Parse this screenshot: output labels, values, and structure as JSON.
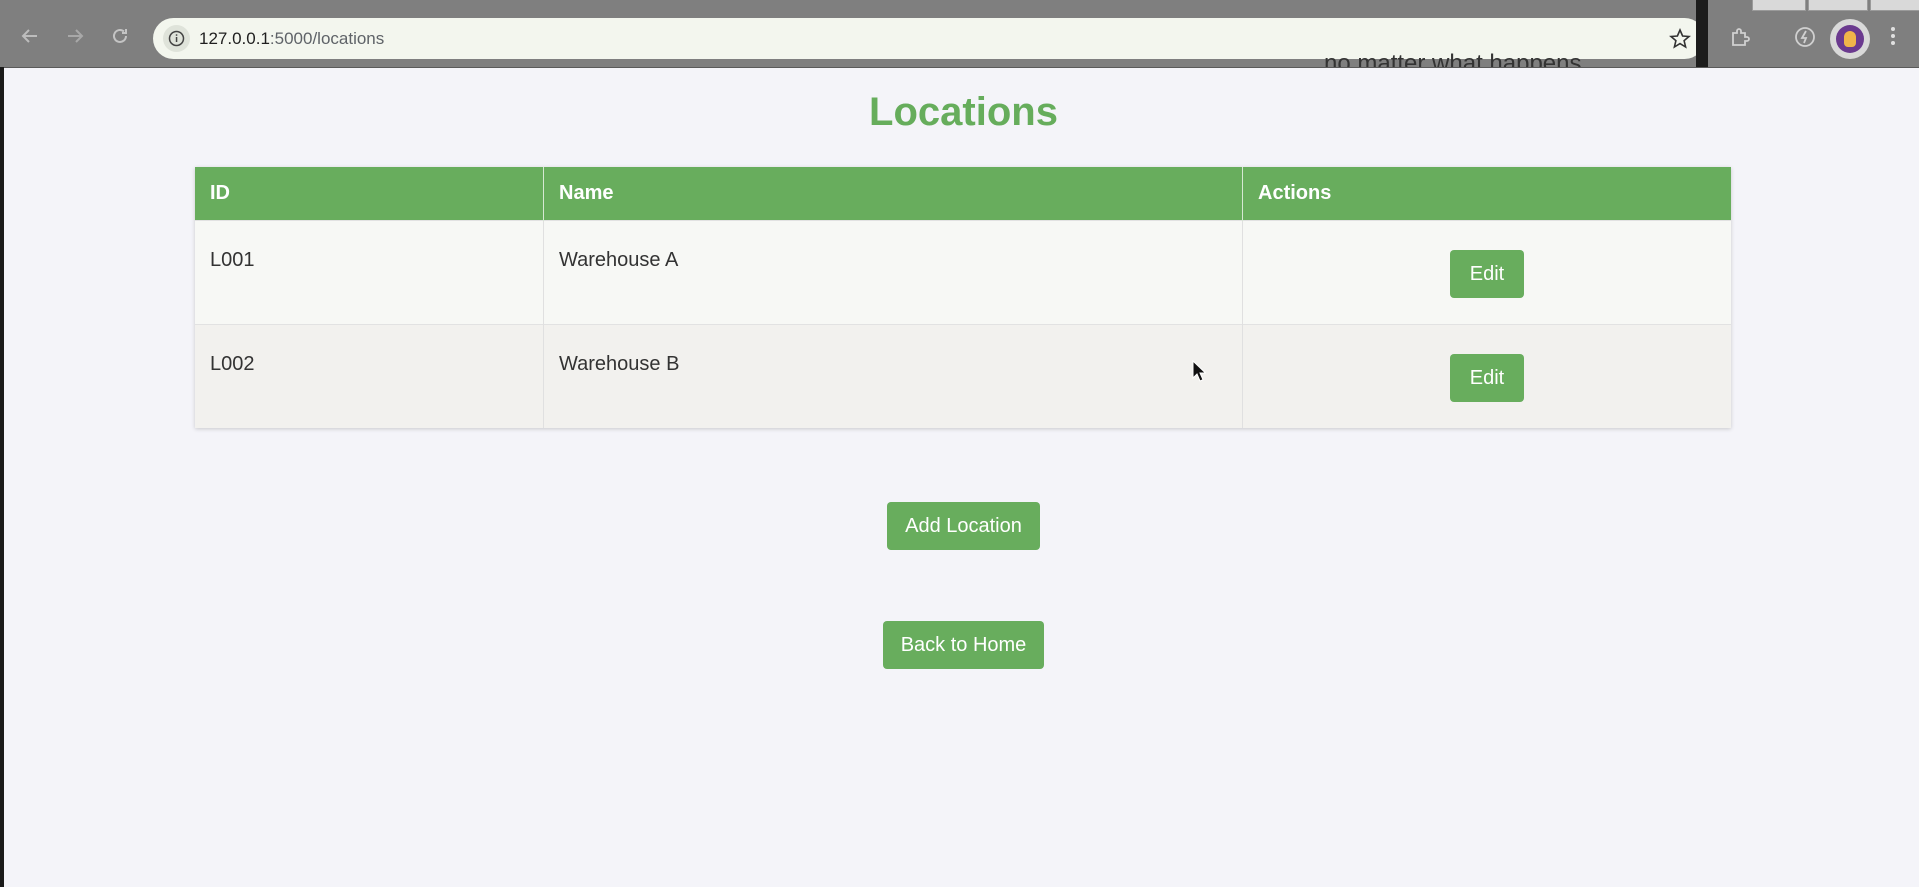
{
  "browser": {
    "url_host": "127.0.0.1",
    "url_rest": ":5000/locations",
    "background_text": "no matter what happens"
  },
  "page": {
    "title": "Locations",
    "accent_color": "#68ad5d"
  },
  "table": {
    "headers": [
      "ID",
      "Name",
      "Actions"
    ],
    "rows": [
      {
        "id": "L001",
        "name": "Warehouse A",
        "action": "Edit"
      },
      {
        "id": "L002",
        "name": "Warehouse B",
        "action": "Edit"
      }
    ]
  },
  "actions": {
    "add_label": "Add Location",
    "home_label": "Back to Home"
  },
  "icons": {
    "back": "back-arrow-icon",
    "forward": "forward-arrow-icon",
    "reload": "reload-icon",
    "site_info": "info-icon",
    "bookmark": "star-icon",
    "extensions": "puzzle-icon",
    "profile": "avatar",
    "menu": "kebab-menu-icon"
  }
}
